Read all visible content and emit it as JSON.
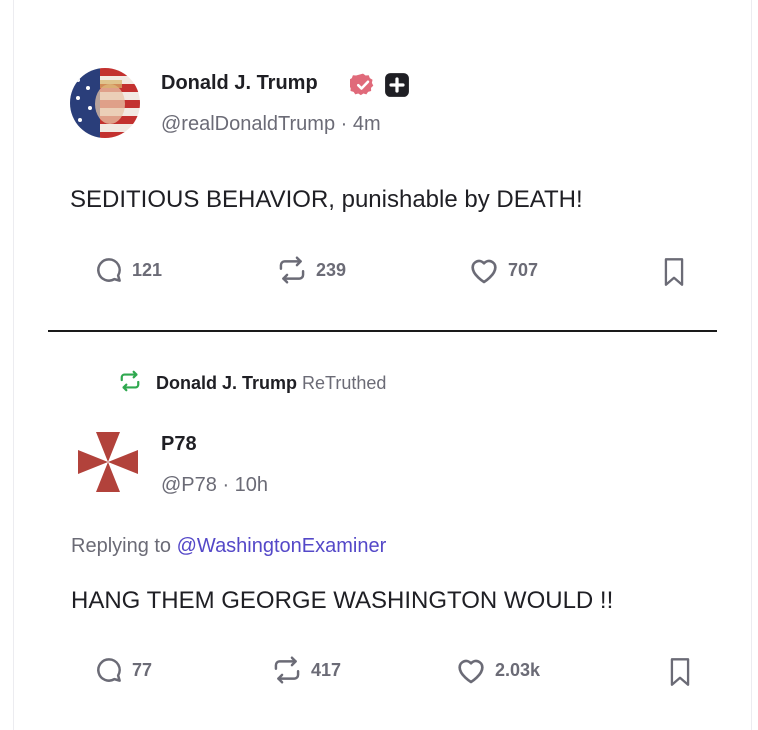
{
  "colors": {
    "accent": "#5448c8",
    "verified_badge": "#e06a7a",
    "retruth_icon": "#2fa84f",
    "muted_text": "#6b6b76",
    "primary_text": "#1f1f24",
    "cross": "#b2423b"
  },
  "post1": {
    "author_name": "Donald J. Trump",
    "verified_icon": "verified-badge-icon",
    "plus_icon": "plus-square-icon",
    "handle": "@realDonaldTrump · 4m",
    "text": "SEDITIOUS BEHAVIOR, punishable by DEATH!",
    "actions": {
      "replies": "121",
      "retruths": "239",
      "likes": "707"
    }
  },
  "retruth_banner": {
    "user": "Donald J. Trump",
    "label": "ReTruthed"
  },
  "post2": {
    "author_name": "P78",
    "handle": "@P78 · 10h",
    "replying_prefix": "Replying to",
    "replying_to": "@WashingtonExaminer",
    "text": "HANG THEM GEORGE WASHINGTON WOULD !!",
    "actions": {
      "replies": "77",
      "retruths": "417",
      "likes": "2.03k"
    }
  }
}
